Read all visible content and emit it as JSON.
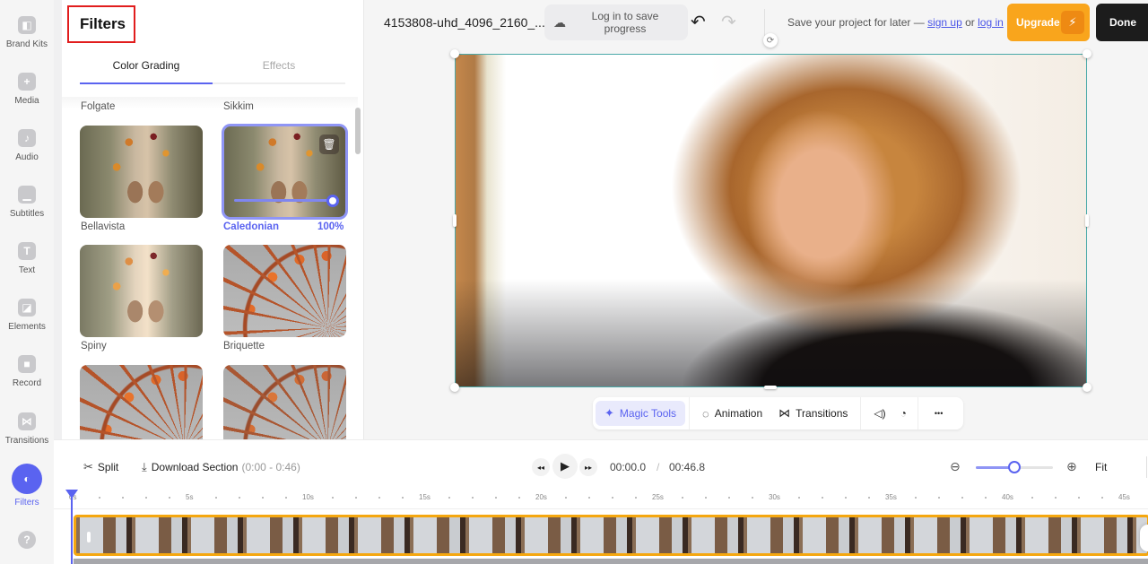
{
  "sidebar": {
    "items": [
      {
        "label": "Brand Kits",
        "icon": "brand-kit-icon",
        "glyph": "◧"
      },
      {
        "label": "Media",
        "icon": "plus-icon",
        "glyph": "+"
      },
      {
        "label": "Audio",
        "icon": "music-note-icon",
        "glyph": "♪"
      },
      {
        "label": "Subtitles",
        "icon": "subtitles-icon",
        "glyph": "▁"
      },
      {
        "label": "Text",
        "icon": "text-icon",
        "glyph": "T"
      },
      {
        "label": "Elements",
        "icon": "elements-icon",
        "glyph": "◪"
      },
      {
        "label": "Record",
        "icon": "camera-icon",
        "glyph": "■"
      },
      {
        "label": "Transitions",
        "icon": "transitions-icon",
        "glyph": "⋈"
      },
      {
        "label": "Filters",
        "icon": "filters-icon",
        "glyph": "◐",
        "active": true
      }
    ],
    "help_glyph": "?"
  },
  "panel": {
    "title": "Filters",
    "tabs": [
      {
        "label": "Color Grading",
        "active": true
      },
      {
        "label": "Effects",
        "active": false
      }
    ],
    "top_labels": [
      "Folgate",
      "Sikkim"
    ],
    "filters": [
      {
        "name": "Bellavista",
        "image": "boots"
      },
      {
        "name": "Caledonian",
        "image": "boots",
        "selected": true,
        "intensity_pct": 100,
        "intensity_label": "100%"
      },
      {
        "name": "Spiny",
        "image": "boots"
      },
      {
        "name": "Briquette",
        "image": "wheel"
      },
      {
        "name": "",
        "image": "wheel"
      },
      {
        "name": "",
        "image": "wheel"
      }
    ],
    "trash_glyph": "🗑"
  },
  "topbar": {
    "project_name": "4153808-uhd_4096_2160_...",
    "save_progress": "Log in to save progress",
    "cloud_glyph": "☁",
    "undo_glyph": "↶",
    "redo_glyph": "↷",
    "save_hint_prefix": "Save your project for later — ",
    "sign_up": "sign up",
    "or": " or ",
    "log_in": "log in",
    "upgrade": "Upgrade",
    "bolt_glyph": "⚡",
    "done": "Done"
  },
  "canvas": {
    "rotate_glyph": "⟳"
  },
  "context_toolbar": {
    "magic_tools": "Magic Tools",
    "magic_glyph": "✦",
    "animation": "Animation",
    "animation_glyph": "◌",
    "transitions": "Transitions",
    "transitions_glyph": "⋈",
    "volume_glyph": "◁)",
    "speed_glyph": "◔",
    "more_glyph": "•••"
  },
  "timeline": {
    "split": "Split",
    "split_glyph": "✂",
    "download": "Download Section",
    "download_glyph": "⤓",
    "download_range": "(0:00 - 0:46)",
    "rewind_glyph": "◂◂",
    "play_glyph": "▶",
    "forward_glyph": "▸▸",
    "current_time": "00:00.0",
    "separator": "/",
    "total_time": "00:46.8",
    "zoom_out_glyph": "⊖",
    "zoom_in_glyph": "⊕",
    "zoom_level": 0.5,
    "fit": "Fit",
    "ruler_labels": [
      "0s",
      "5s",
      "10s",
      "15s",
      "20s",
      "25s",
      "30s",
      "35s",
      "40s",
      "45s"
    ]
  }
}
